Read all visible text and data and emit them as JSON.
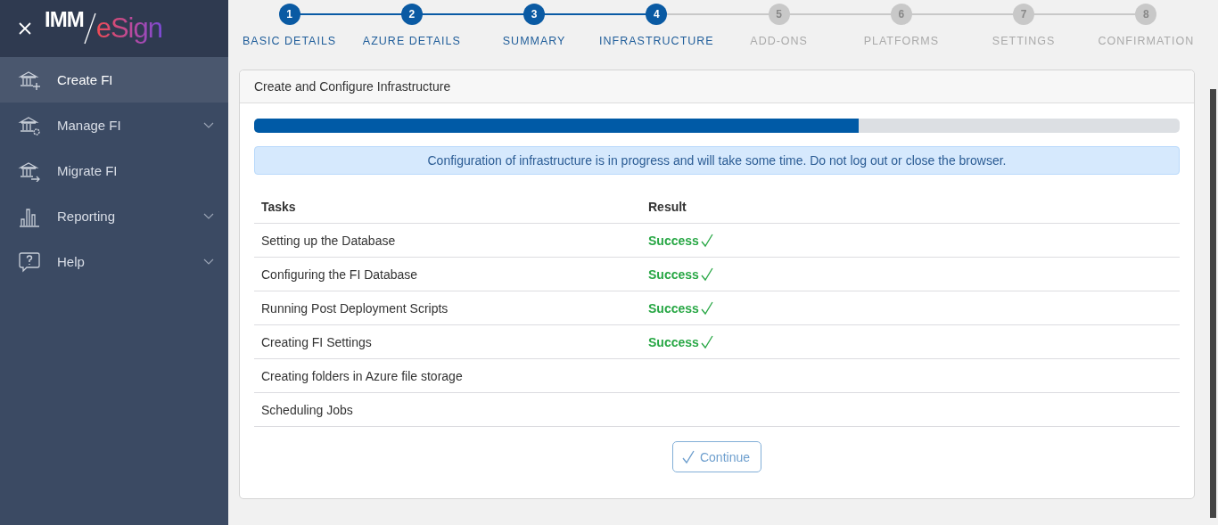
{
  "logo": {
    "part_1": "IMM",
    "part_2": "eSign"
  },
  "sidebar": {
    "items": [
      {
        "label": "Create FI",
        "kind": "bank-plus",
        "selected": true,
        "expandable": false
      },
      {
        "label": "Manage FI",
        "kind": "bank-gear",
        "selected": false,
        "expandable": true
      },
      {
        "label": "Migrate FI",
        "kind": "bank-arrow",
        "selected": false,
        "expandable": false
      },
      {
        "label": "Reporting",
        "kind": "chart",
        "selected": false,
        "expandable": true
      },
      {
        "label": "Help",
        "kind": "help",
        "selected": false,
        "expandable": true
      }
    ]
  },
  "steps": [
    {
      "number": "1",
      "label": "BASIC DETAILS",
      "reached": true
    },
    {
      "number": "2",
      "label": "AZURE DETAILS",
      "reached": true
    },
    {
      "number": "3",
      "label": "SUMMARY",
      "reached": true
    },
    {
      "number": "4",
      "label": "INFRASTRUCTURE",
      "reached": true
    },
    {
      "number": "5",
      "label": "ADD-ONS",
      "reached": false
    },
    {
      "number": "6",
      "label": "PLATFORMS",
      "reached": false
    },
    {
      "number": "7",
      "label": "SETTINGS",
      "reached": false
    },
    {
      "number": "8",
      "label": "CONFIRMATION",
      "reached": false
    }
  ],
  "card": {
    "title": "Create and Configure Infrastructure",
    "progress": {
      "level": 0.653
    },
    "alert": "Configuration of infrastructure is in progress and will take some time. Do not log out or close the browser.",
    "table": {
      "columns": [
        "Tasks",
        "Result"
      ],
      "rows": [
        {
          "task": "Setting up the Database",
          "result": "Success",
          "kind": "success"
        },
        {
          "task": "Configuring the FI Database",
          "result": "Success",
          "kind": "success"
        },
        {
          "task": "Running Post Deployment Scripts",
          "result": "Success",
          "kind": "success"
        },
        {
          "task": "Creating FI Settings",
          "result": "Success",
          "kind": "success"
        },
        {
          "task": "Creating folders in Azure file storage",
          "kind": "pending"
        },
        {
          "task": "Scheduling Jobs",
          "kind": "pending"
        }
      ]
    },
    "button": {
      "label": "Continue",
      "disabled": true
    }
  }
}
